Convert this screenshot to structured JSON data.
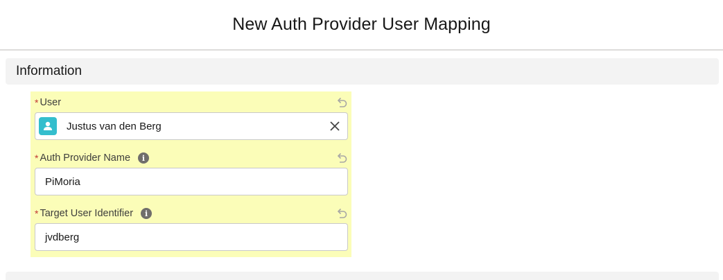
{
  "modal": {
    "title": "New Auth Provider User Mapping"
  },
  "section": {
    "title": "Information"
  },
  "fields": {
    "user": {
      "label": "User",
      "value": "Justus van den Berg",
      "required": "*"
    },
    "auth_provider": {
      "label": "Auth Provider Name",
      "value": "PiMoria",
      "required": "*"
    },
    "target_identifier": {
      "label": "Target User Identifier",
      "value": "jvdberg",
      "required": "*"
    }
  },
  "icons": {
    "undo": "undo-icon",
    "info": "info-icon",
    "clear": "close-icon",
    "user_avatar": "user-icon"
  },
  "colors": {
    "highlight": "#fbfdb8",
    "avatar": "#34becd",
    "required": "#c23934",
    "section_bg": "#f3f3f3"
  }
}
